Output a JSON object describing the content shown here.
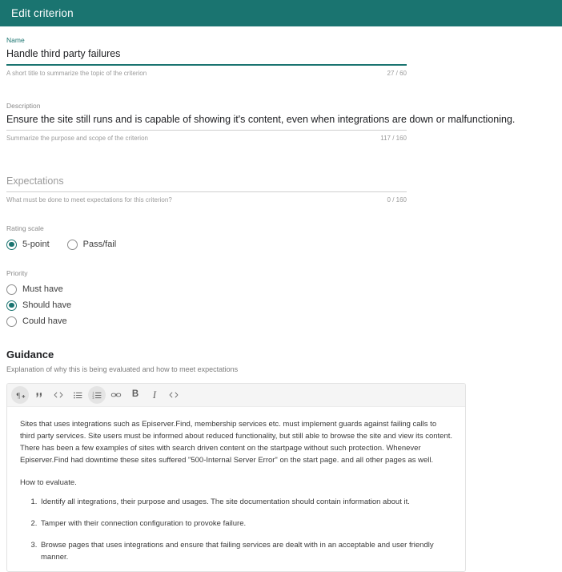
{
  "header": {
    "title": "Edit criterion",
    "bg_color": "#1a7470"
  },
  "accent_color": "#1a7470",
  "fields": {
    "name": {
      "label": "Name",
      "value": "Handle third party failures",
      "hint": "A short title to summarize the topic of the criterion",
      "counter": "27 / 60"
    },
    "description": {
      "label": "Description",
      "value": "Ensure the site still runs and is capable of showing it's content, even when integrations are down or malfunctioning.",
      "hint": "Summarize the purpose and scope of the criterion",
      "counter": "117 / 160"
    },
    "expectations": {
      "placeholder": "Expectations",
      "value": "",
      "hint": "What must be done to meet expectations for this criterion?",
      "counter": "0 / 160"
    }
  },
  "rating_scale": {
    "label": "Rating scale",
    "options": [
      {
        "label": "5-point",
        "selected": true
      },
      {
        "label": "Pass/fail",
        "selected": false
      }
    ]
  },
  "priority": {
    "label": "Priority",
    "options": [
      {
        "label": "Must have",
        "selected": false
      },
      {
        "label": "Should have",
        "selected": true
      },
      {
        "label": "Could have",
        "selected": false
      }
    ]
  },
  "guidance": {
    "title": "Guidance",
    "subtitle": "Explanation of why this is being evaluated and how to meet expectations",
    "toolbar": [
      {
        "name": "paragraph-style-icon",
        "glyph": "¶",
        "active": true
      },
      {
        "name": "blockquote-icon",
        "glyph": "”",
        "active": false
      },
      {
        "name": "code-block-icon",
        "glyph": "<>",
        "active": false
      },
      {
        "name": "bulleted-list-icon",
        "glyph": "list-ul",
        "active": false
      },
      {
        "name": "numbered-list-icon",
        "glyph": "list-ol",
        "active": true
      },
      {
        "name": "link-icon",
        "glyph": "link",
        "active": false
      },
      {
        "name": "bold-icon",
        "glyph": "B",
        "active": false
      },
      {
        "name": "italic-icon",
        "glyph": "I",
        "active": false
      },
      {
        "name": "inline-code-icon",
        "glyph": "<>",
        "active": false
      }
    ],
    "content": {
      "paragraph_1": "Sites that uses integrations such as Episerver.Find, membership services etc. must implement guards against failing calls to third party services. Site users must be informed about reduced functionality, but still able to browse the site and view its content.",
      "paragraph_2": "There has been a few examples of sites with search driven content on the startpage without such protection. Whenever Episerver.Find had downtime these sites suffered \"500-Internal Server Error\" on the start page. and all other pages as well.",
      "paragraph_3": "How to evaluate.",
      "list_items": [
        "Identify all integrations, their purpose and usages. The site documentation should contain information about it.",
        "Tamper with their connection configuration to provoke failure.",
        "Browse pages that uses integrations and ensure that failing services are dealt with in an acceptable and user friendly manner."
      ]
    }
  }
}
